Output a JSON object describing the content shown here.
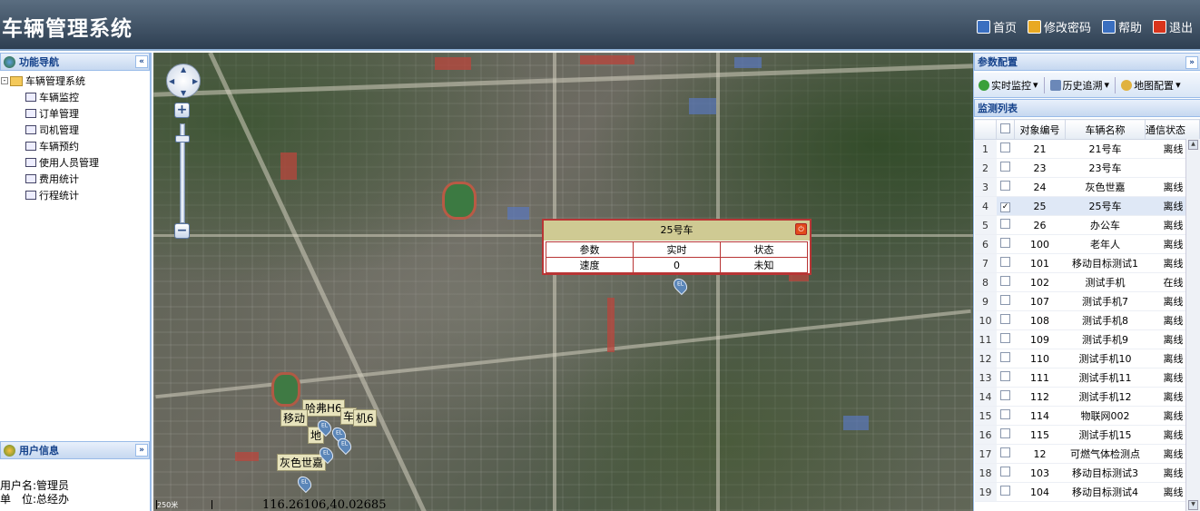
{
  "header": {
    "title": "车辆管理系统"
  },
  "topnav": [
    {
      "label": "首页",
      "icon": "home-icon",
      "color": "#3a6fc0"
    },
    {
      "label": "修改密码",
      "icon": "key-icon",
      "color": "#e9a923"
    },
    {
      "label": "帮助",
      "icon": "help-icon",
      "color": "#3a6fc0"
    },
    {
      "label": "退出",
      "icon": "power-icon",
      "color": "#d9341c"
    }
  ],
  "left": {
    "nav_title": "功能导航",
    "tree_root": "车辆管理系统",
    "tree_items": [
      "车辆监控",
      "订单管理",
      "司机管理",
      "车辆预约",
      "使用人员管理",
      "费用统计",
      "行程统计"
    ],
    "user_title": "用户信息",
    "user_name_label": "用户名:",
    "user_name": "管理员",
    "unit_label": "单　位:",
    "unit": "总经办"
  },
  "map": {
    "popup": {
      "title": "25号车",
      "headers": [
        "参数",
        "实时",
        "状态"
      ],
      "row": [
        "速度",
        "0",
        "未知"
      ]
    },
    "labels": [
      "哈弗H6",
      "移动",
      "车",
      "机6",
      "地",
      "灰色世嘉"
    ],
    "pin_text": "EL",
    "scale_text": "250米",
    "coord_text": "116.26106,40.02685"
  },
  "right": {
    "param_title": "参数配置",
    "toolbar": [
      "实时监控",
      "历史追溯",
      "地图配置"
    ],
    "monitor_title": "监测列表",
    "columns": [
      "对象编号",
      "车辆名称",
      "通信状态"
    ],
    "rows": [
      {
        "n": "1",
        "checked": "",
        "id": "21",
        "name": "21号车",
        "status": "离线"
      },
      {
        "n": "2",
        "checked": "",
        "id": "23",
        "name": "23号车",
        "status": ""
      },
      {
        "n": "3",
        "checked": "",
        "id": "24",
        "name": "灰色世嘉",
        "status": "离线"
      },
      {
        "n": "4",
        "checked": "✓",
        "id": "25",
        "name": "25号车",
        "status": "离线"
      },
      {
        "n": "5",
        "checked": "",
        "id": "26",
        "name": "办公车",
        "status": "离线"
      },
      {
        "n": "6",
        "checked": "",
        "id": "100",
        "name": "老年人",
        "status": "离线"
      },
      {
        "n": "7",
        "checked": "",
        "id": "101",
        "name": "移动目标测试1",
        "status": "离线"
      },
      {
        "n": "8",
        "checked": "",
        "id": "102",
        "name": "测试手机",
        "status": "在线"
      },
      {
        "n": "9",
        "checked": "",
        "id": "107",
        "name": "测试手机7",
        "status": "离线"
      },
      {
        "n": "10",
        "checked": "",
        "id": "108",
        "name": "测试手机8",
        "status": "离线"
      },
      {
        "n": "11",
        "checked": "",
        "id": "109",
        "name": "测试手机9",
        "status": "离线"
      },
      {
        "n": "12",
        "checked": "",
        "id": "110",
        "name": "测试手机10",
        "status": "离线"
      },
      {
        "n": "13",
        "checked": "",
        "id": "111",
        "name": "测试手机11",
        "status": "离线"
      },
      {
        "n": "14",
        "checked": "",
        "id": "112",
        "name": "测试手机12",
        "status": "离线"
      },
      {
        "n": "15",
        "checked": "",
        "id": "114",
        "name": "物联网002",
        "status": "离线"
      },
      {
        "n": "16",
        "checked": "",
        "id": "115",
        "name": "测试手机15",
        "status": "离线"
      },
      {
        "n": "17",
        "checked": "",
        "id": "12",
        "name": "可燃气体检测点",
        "status": "离线"
      },
      {
        "n": "18",
        "checked": "",
        "id": "103",
        "name": "移动目标测试3",
        "status": "离线"
      },
      {
        "n": "19",
        "checked": "",
        "id": "104",
        "name": "移动目标测试4",
        "status": "离线"
      }
    ]
  }
}
